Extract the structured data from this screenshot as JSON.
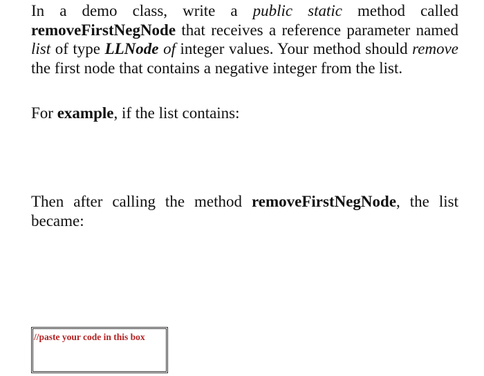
{
  "paragraphs": {
    "intro": {
      "t1": "In a demo class, write a ",
      "t2_italic": "public static",
      "t3": " method called ",
      "t4_bold": "removeFirstNegNode",
      "t5": " that receives a reference parameter named ",
      "t6_italic": "list",
      "t7": " of type ",
      "t8_bold_italic": "LLNode",
      "t9": " ",
      "t10_italic": "of",
      "t11": " integer values. Your method should ",
      "t12_italic": "remove",
      "t13": " the first node that contains a negative integer from the list."
    },
    "example": {
      "t1": "For ",
      "t2_bold": "example",
      "t3": ", if the list contains:"
    },
    "after": {
      "t1": "Then after calling the method ",
      "t2_bold": "removeFirstNegNode",
      "t3": ", the list became:"
    }
  },
  "code_box": {
    "placeholder": "//paste your code in this box",
    "placeholder_color": "#b22222",
    "border_color": "#333333"
  }
}
